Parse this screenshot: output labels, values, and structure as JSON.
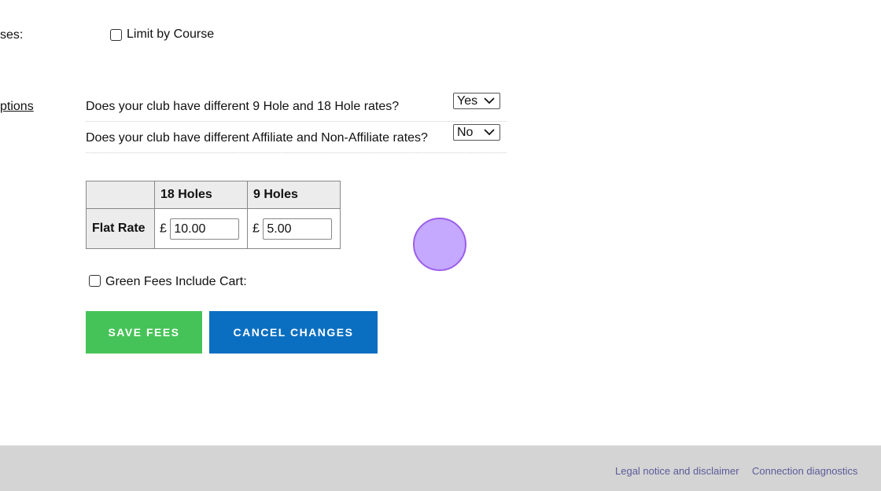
{
  "left_labels": {
    "courses_partial": "ses:",
    "options_partial": "ptions"
  },
  "limit_by_course": {
    "label": "Limit by Course",
    "checked": false
  },
  "questions": [
    {
      "text": "Does your club have different 9 Hole and 18 Hole rates?",
      "value": "Yes"
    },
    {
      "text": "Does your club have different Affiliate and Non-Affiliate rates?",
      "value": "No"
    }
  ],
  "fees_table": {
    "headers": [
      "",
      "18 Holes",
      "9 Holes"
    ],
    "row_label": "Flat Rate",
    "currency": "£",
    "values": [
      "10.00",
      "5.00"
    ]
  },
  "green_fees_cart": {
    "label": "Green Fees Include Cart:",
    "checked": false
  },
  "buttons": {
    "save": "SAVE FEES",
    "cancel": "CANCEL CHANGES"
  },
  "colors": {
    "save": "#46c358",
    "cancel": "#0b6fc1",
    "footer": "#d4d4d4",
    "footer_link": "#5b5b9a"
  },
  "footer": {
    "legal": "Legal notice and disclaimer",
    "diagnostics": "Connection diagnostics"
  }
}
